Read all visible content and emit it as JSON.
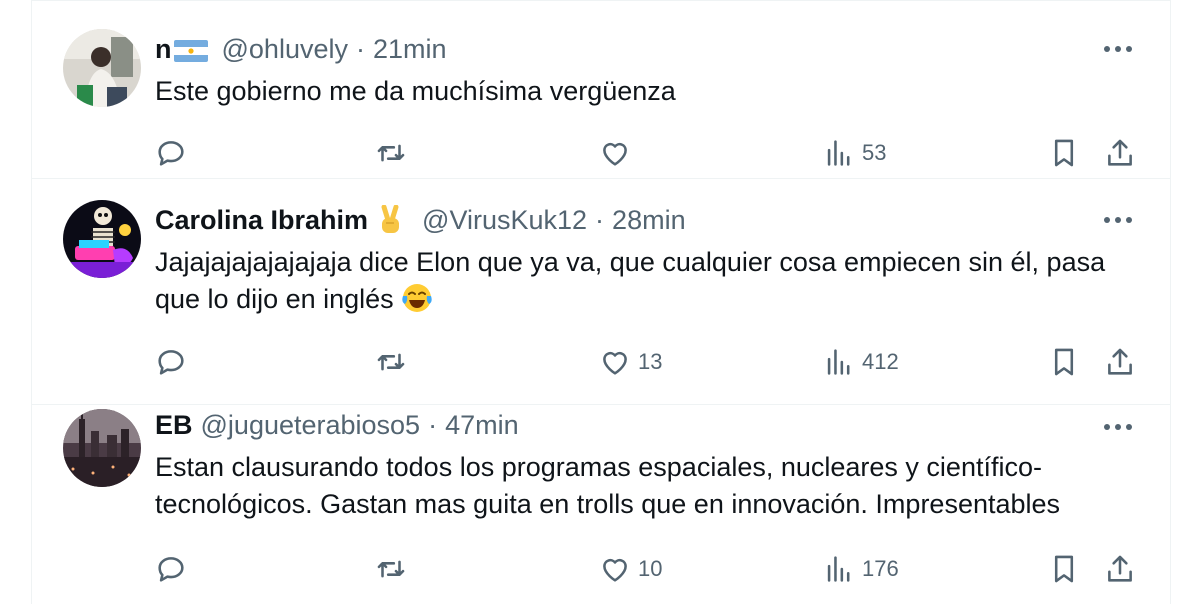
{
  "tweets": [
    {
      "name": "n",
      "handle": "@ohluvely",
      "time": "21min",
      "text": "Este gobierno me da muchísima vergüenza",
      "stats": {
        "replies": "",
        "retweets": "",
        "likes": "",
        "views": "53"
      }
    },
    {
      "name": "Carolina Ibrahim",
      "handle": "@VirusKuk12",
      "time": "28min",
      "text": "Jajajajajajajajaja dice Elon que ya va,  que cualquier cosa empiecen sin él, pasa que lo dijo en inglés",
      "stats": {
        "replies": "",
        "retweets": "",
        "likes": "13",
        "views": "412"
      }
    },
    {
      "name": "EB",
      "handle": "@jugueterabioso5",
      "time": "47min",
      "text": "Estan clausurando todos los programas espaciales, nucleares y científico-tecnológicos. Gastan mas guita en trolls que en innovación. Impresentables",
      "stats": {
        "replies": "",
        "retweets": "",
        "likes": "10",
        "views": "176"
      }
    }
  ],
  "separator": "·",
  "icons": [
    "reply-icon",
    "retweet-icon",
    "like-icon",
    "views-icon",
    "bookmark-icon",
    "share-icon",
    "more-icon",
    "argentina-flag-icon",
    "victory-hand-icon",
    "tears-of-joy-icon"
  ],
  "colors": {
    "text": "#0f1419",
    "secondary": "#536471",
    "border": "#eff3f4"
  }
}
